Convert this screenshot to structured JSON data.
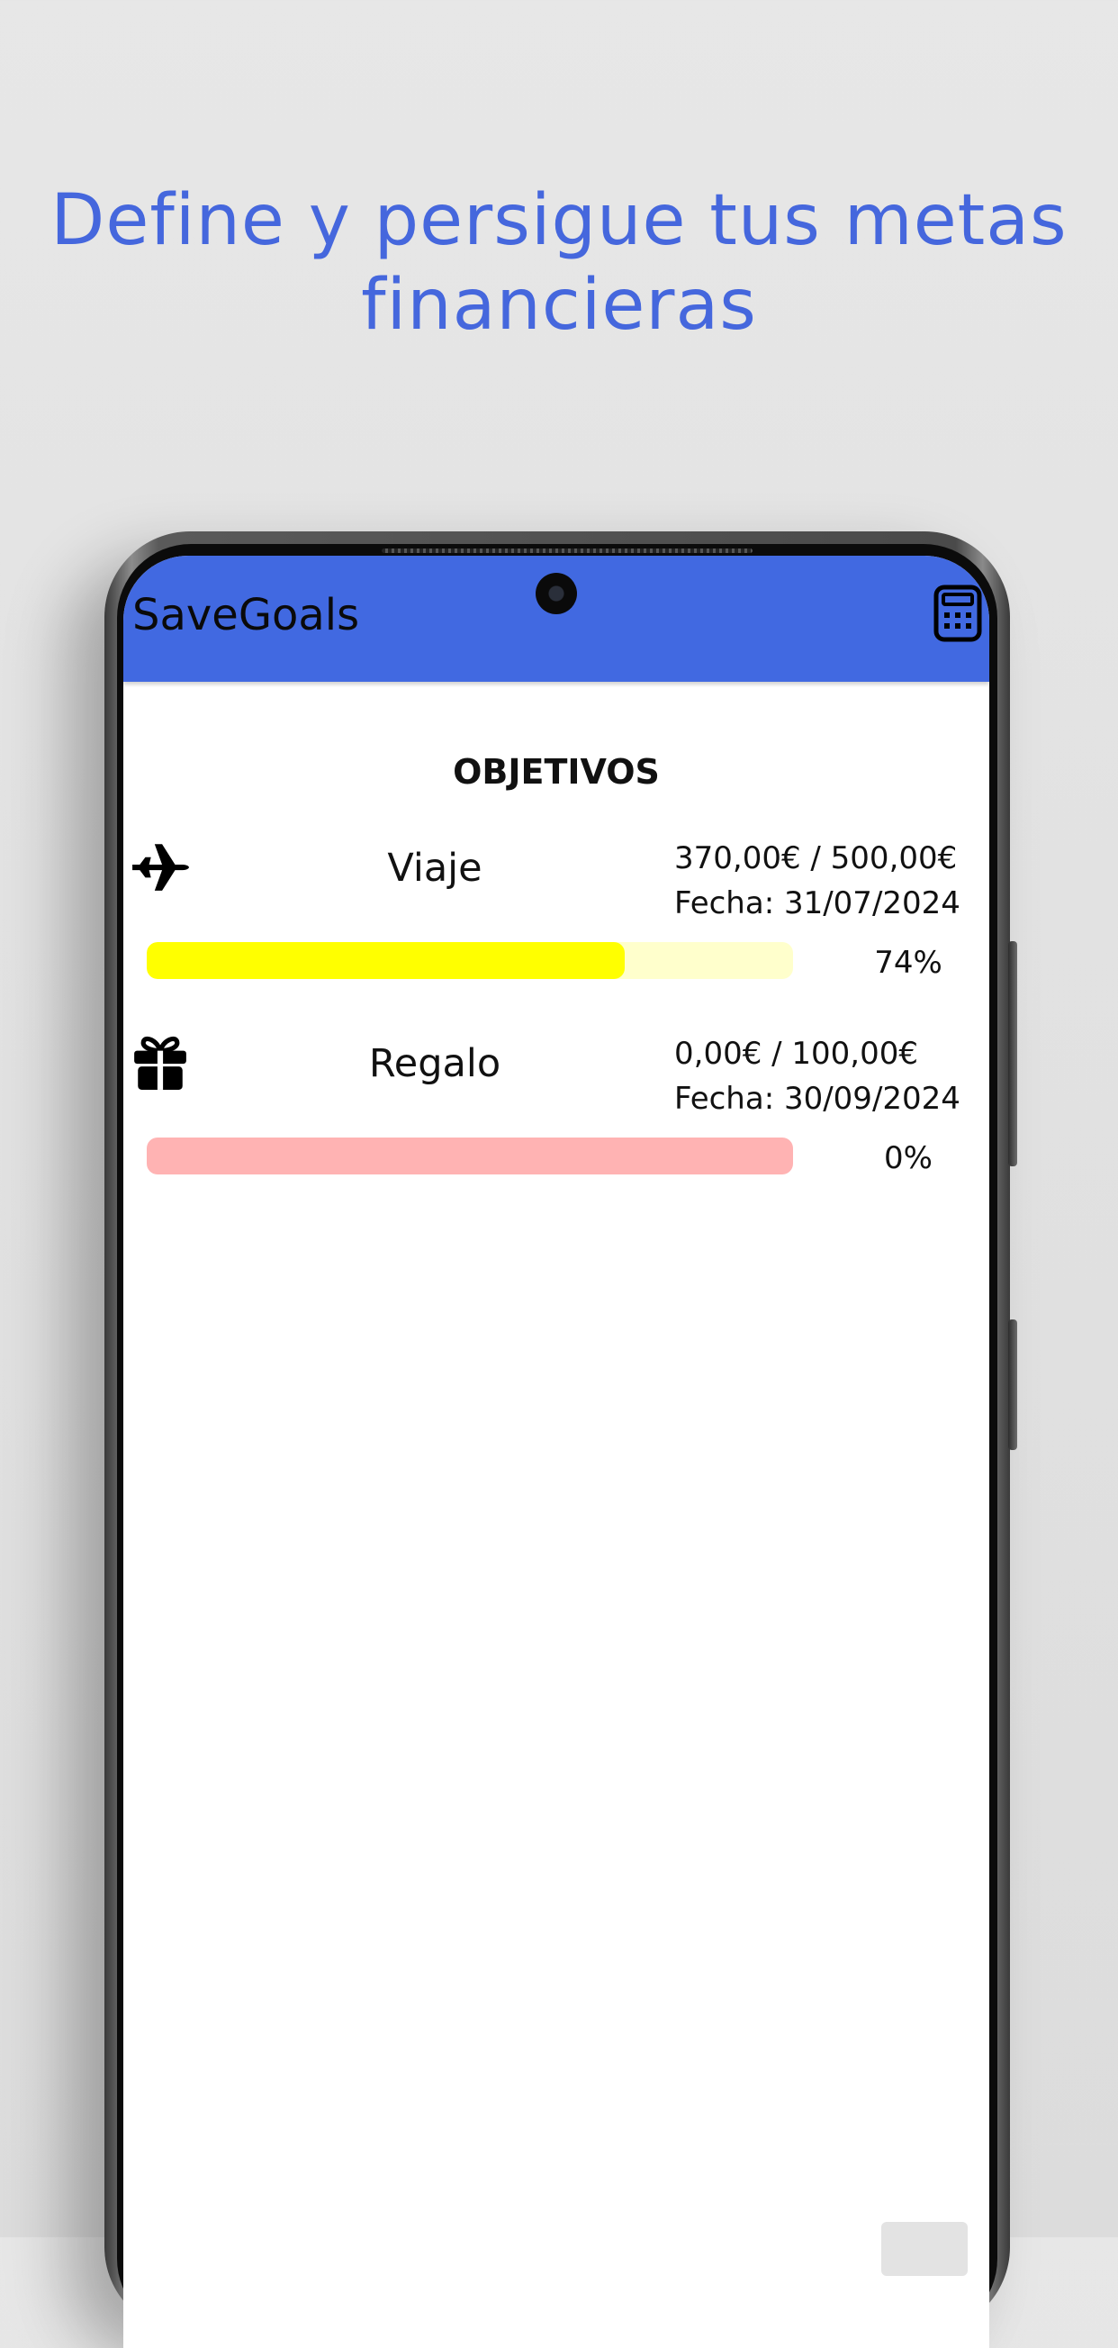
{
  "promo": {
    "line1": "Define y persigue tus metas",
    "line2": "financieras"
  },
  "app": {
    "title": "SaveGoals",
    "calculator_icon": "calculator-icon",
    "accent_color": "#4169e1"
  },
  "section": {
    "title": "OBJETIVOS"
  },
  "goals": [
    {
      "icon": "airplane-icon",
      "name": "Viaje",
      "amount": "370,00€ / 500,00€",
      "date": "Fecha: 31/07/2024",
      "progress": 0.74,
      "percent_label": "74%",
      "track_color": "#ffffcc",
      "fill_color": "#ffff00"
    },
    {
      "icon": "gift-icon",
      "name": "Regalo",
      "amount": "0,00€ / 100,00€",
      "date": "Fecha: 30/09/2024",
      "progress": 0,
      "percent_label": "0%",
      "track_color": "#ffb3b3",
      "fill_color": "#ff8080"
    }
  ]
}
